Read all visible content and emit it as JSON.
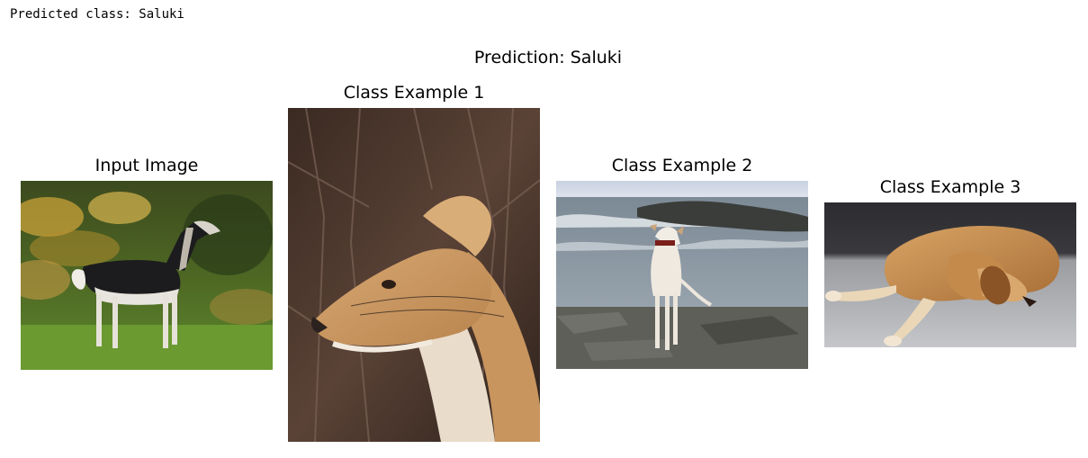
{
  "stdout": {
    "text": "Predicted class: Saluki"
  },
  "figure": {
    "suptitle": "Prediction: Saluki",
    "panels": [
      {
        "title": "Input Image",
        "image": "photo of a black-and-white saluki standing on grass"
      },
      {
        "title": "Class Example 1",
        "image": "close-up photo of a cream saluki head with windblown ear feathering"
      },
      {
        "title": "Class Example 2",
        "image": "photo of a white saluki standing on rocks at the seashore"
      },
      {
        "title": "Class Example 3",
        "image": "photo of a tan saluki lying curled on a grey carpet"
      }
    ]
  }
}
